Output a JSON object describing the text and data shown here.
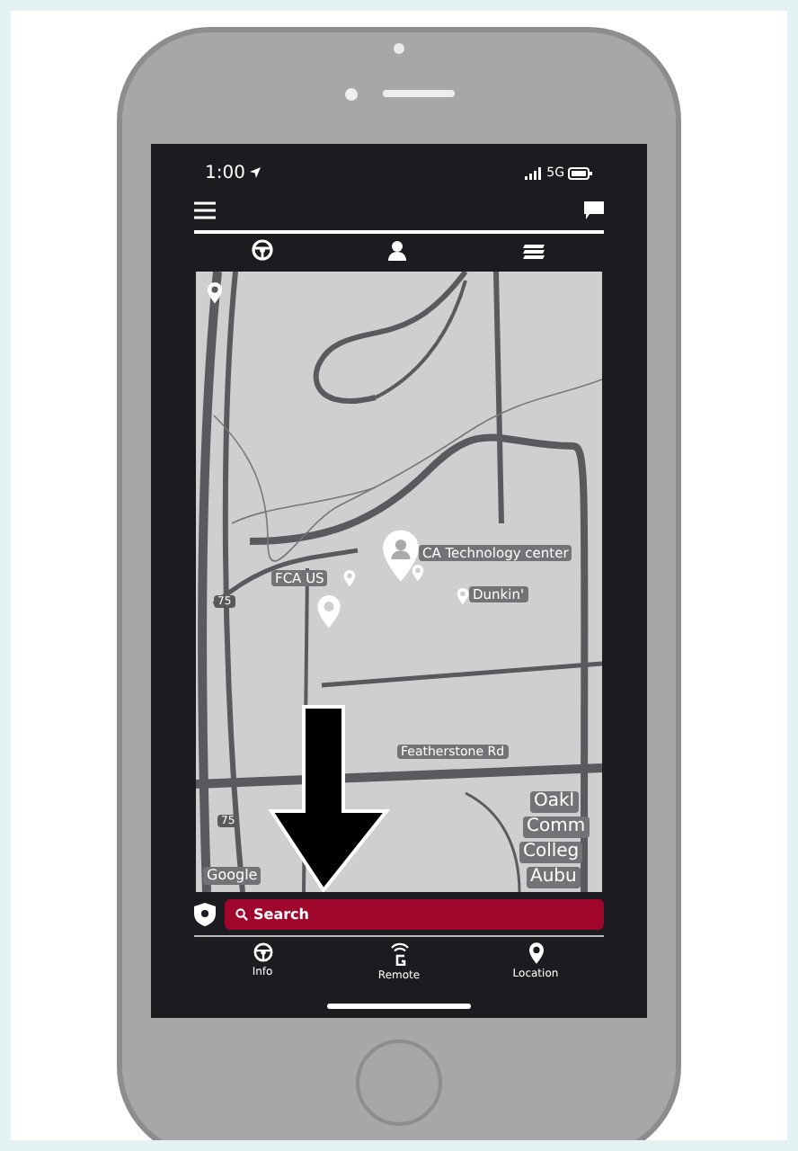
{
  "status_bar": {
    "time": "1:00",
    "network": "5G"
  },
  "top_tabs": [
    {
      "kind": "vehicle"
    },
    {
      "kind": "profile"
    },
    {
      "kind": "layers"
    }
  ],
  "map": {
    "labels": [
      {
        "kind": "place",
        "text": "CA Technology center"
      },
      {
        "kind": "place",
        "text": "FCA US"
      },
      {
        "kind": "place",
        "text": "Dunkin'"
      },
      {
        "kind": "road",
        "text": "Featherstone Rd"
      },
      {
        "kind": "area",
        "text": "Oakl"
      },
      {
        "kind": "area",
        "text": "Comm"
      },
      {
        "kind": "area",
        "text": "Colleg"
      },
      {
        "kind": "area",
        "text": "Aubu"
      },
      {
        "kind": "shield",
        "text": "75"
      },
      {
        "kind": "shield",
        "text": "75"
      },
      {
        "kind": "credit",
        "text": "Google"
      }
    ]
  },
  "search": {
    "placeholder": "Search"
  },
  "nav": [
    {
      "kind": "info",
      "label": "Info"
    },
    {
      "kind": "remote",
      "label": "Remote"
    },
    {
      "kind": "location",
      "label": "Location"
    }
  ]
}
